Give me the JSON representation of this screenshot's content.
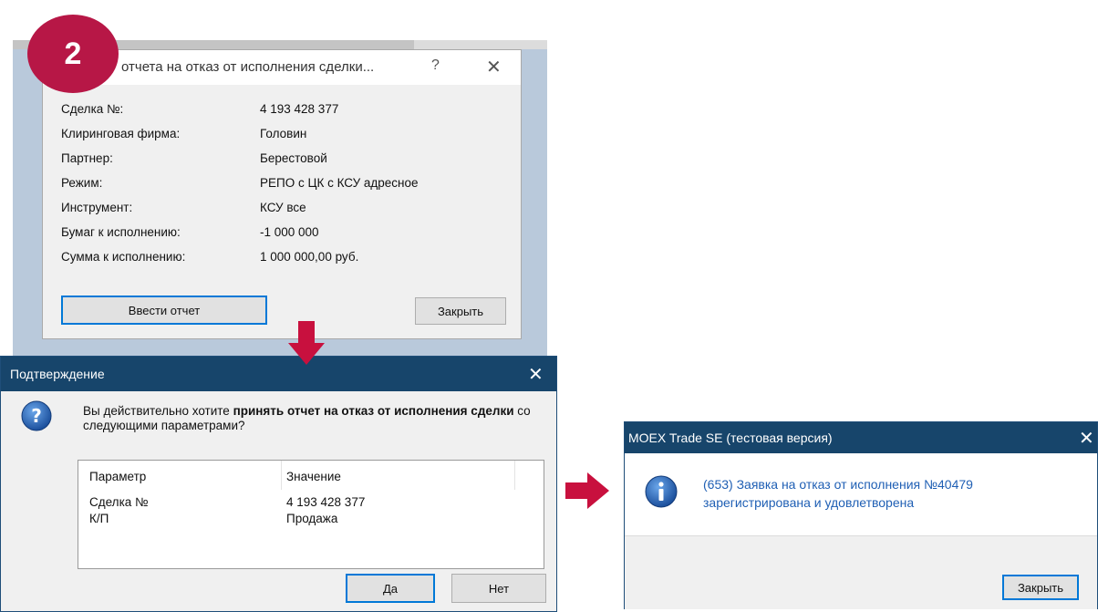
{
  "badge": {
    "number": "2"
  },
  "dialog1": {
    "title": "отчета на отказ от исполнения сделки...",
    "help_glyph": "?",
    "close_glyph": "✕",
    "fields": [
      {
        "label": "Сделка №:",
        "value": "4 193 428 377"
      },
      {
        "label": "Клиринговая фирма:",
        "value": "Головин"
      },
      {
        "label": "Партнер:",
        "value": "Берестовой"
      },
      {
        "label": "Режим:",
        "value": "РЕПО с ЦК с КСУ адресное"
      },
      {
        "label": "Инструмент:",
        "value": "КСУ все"
      },
      {
        "label": "Бумаг к исполнению:",
        "value": "-1 000 000"
      },
      {
        "label": "Сумма к исполнению:",
        "value": "1 000 000,00 руб."
      }
    ],
    "submit_label": "Ввести отчет",
    "close_label": "Закрыть"
  },
  "dialog2": {
    "title": "Подтверждение",
    "close_glyph": "✕",
    "message_prefix": "Вы действительно хотите ",
    "message_bold": "принять отчет на отказ от исполнения сделки",
    "message_suffix": " со следующими параметрами?",
    "table": {
      "headers": [
        "Параметр",
        "Значение"
      ],
      "rows": [
        {
          "param": "Сделка №",
          "value": "4 193 428 377"
        },
        {
          "param": "К/П",
          "value": "Продажа"
        }
      ]
    },
    "yes_label": "Да",
    "no_label": "Нет"
  },
  "dialog3": {
    "title": "MOEX Trade SE (тестовая версия)",
    "close_glyph": "✕",
    "message_line1": "(653) Заявка на отказ от исполнения №40479",
    "message_line2": "зарегистрирована и удовлетворена",
    "close_label": "Закрыть"
  },
  "colors": {
    "accent_badge": "#b71746",
    "arrow": "#c8103e",
    "titlebar": "#17456b",
    "info_text": "#1f5fb4",
    "focus_border": "#0078d7"
  }
}
